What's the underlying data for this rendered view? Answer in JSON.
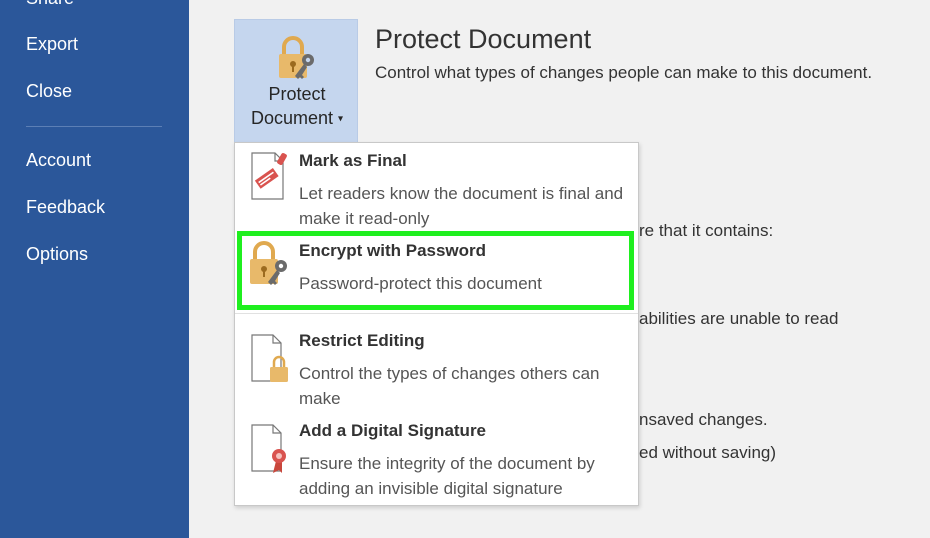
{
  "sidebar": {
    "items": [
      {
        "label": "Share"
      },
      {
        "label": "Export"
      },
      {
        "label": "Close"
      },
      {
        "label": "Account"
      },
      {
        "label": "Feedback"
      },
      {
        "label": "Options"
      }
    ]
  },
  "protect_button": {
    "line1": "Protect",
    "line2": "Document",
    "caret": "▾",
    "icon": "lock-key-icon"
  },
  "section": {
    "title": "Protect Document",
    "description": "Control what types of changes people can make to this document."
  },
  "background_text": [
    "re that it contains:",
    "abilities are unable to read",
    "nsaved changes.",
    "ed without saving)"
  ],
  "menu": {
    "items": [
      {
        "title": "Mark as Final",
        "description": "Let readers know the document is final and make it read-only",
        "icon": "mark-final-stamp-icon"
      },
      {
        "title": "Encrypt with Password",
        "description": "Password-protect this document",
        "icon": "lock-key-icon"
      },
      {
        "title": "Restrict Editing",
        "description": "Control the types of changes others can make",
        "icon": "document-lock-icon"
      },
      {
        "title": "Add a Digital Signature",
        "description": "Ensure the integrity of the document by adding an invisible digital signature",
        "icon": "document-ribbon-icon"
      }
    ]
  },
  "colors": {
    "sidebar": "#2b579a",
    "button_selected": "#c5d6ee",
    "highlight": "#1fef1f",
    "lock": "#e8b96a"
  }
}
